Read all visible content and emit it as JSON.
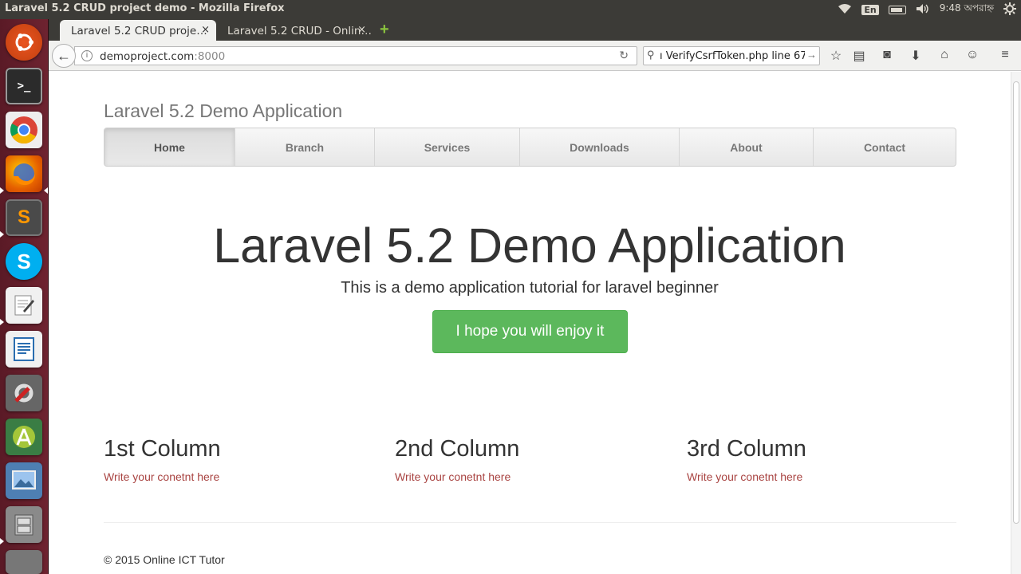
{
  "system": {
    "window_title": "Laravel 5.2 CRUD project demo - Mozilla Firefox",
    "keyboard_lang": "En",
    "clock": "9:48 অপরাহ্ন"
  },
  "launcher": {
    "apps": [
      "ubuntu-dash",
      "terminal",
      "chrome",
      "firefox",
      "sublime-text",
      "skype",
      "text-editor",
      "libreoffice-writer",
      "system-settings",
      "android-studio",
      "image-viewer",
      "file-cabinet"
    ]
  },
  "browser": {
    "tabs": [
      {
        "label": "Laravel 5.2 CRUD proje…",
        "close": "×"
      },
      {
        "label": "Laravel 5.2 CRUD - Onlin…",
        "close": "×"
      }
    ],
    "new_tab": "+",
    "url_host": "demoproject.com",
    "url_port": ":8000",
    "search_text": "ı VerifyCsrfToken.php line 67:"
  },
  "page": {
    "brand": "Laravel 5.2 Demo Application",
    "nav": [
      "Home",
      "Branch",
      "Services",
      "Downloads",
      "About",
      "Contact"
    ],
    "nav_active": "Home",
    "hero_title": "Laravel 5.2 Demo Application",
    "hero_subtitle": "This is a demo application tutorial for laravel beginner",
    "hero_button": "I hope you will enjoy it",
    "columns": [
      {
        "title": "1st Column",
        "text": "Write your conetnt here"
      },
      {
        "title": "2nd Column",
        "text": "Write your conetnt here"
      },
      {
        "title": "3rd Column",
        "text": "Write your conetnt here"
      }
    ],
    "footer": "© 2015 Online ICT Tutor"
  },
  "colors": {
    "success_button": "#5cb85c",
    "column_text": "#a94442",
    "launcher_bg": "#6e2330",
    "titlebar_bg": "#3c3b37"
  }
}
